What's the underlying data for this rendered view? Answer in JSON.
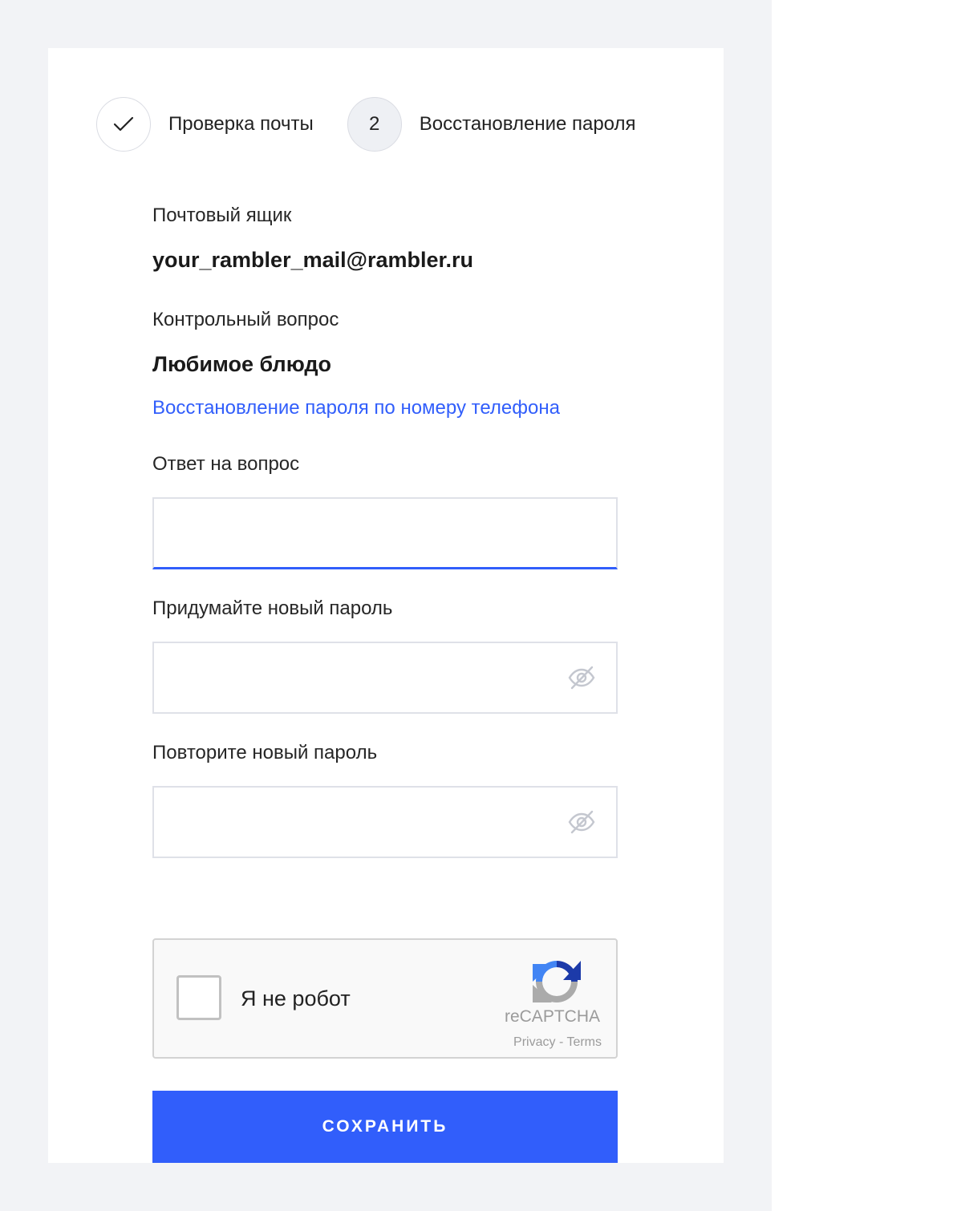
{
  "steps": [
    {
      "label": "Проверка почты",
      "state": "done",
      "icon": "check-icon"
    },
    {
      "number": "2",
      "label": "Восстановление пароля",
      "state": "active"
    }
  ],
  "mailbox": {
    "label": "Почтовый ящик",
    "value": "your_rambler_mail@rambler.ru"
  },
  "security_question": {
    "label": "Контрольный вопрос",
    "value": "Любимое блюдо"
  },
  "phone_recovery_link": "Восстановление пароля по номеру телефона",
  "answer": {
    "label": "Ответ на вопрос",
    "value": "",
    "placeholder": ""
  },
  "new_password": {
    "label": "Придумайте новый пароль",
    "value": "",
    "placeholder": "",
    "icon": "eye-hidden-icon"
  },
  "repeat_password": {
    "label": "Повторите новый пароль",
    "value": "",
    "placeholder": "",
    "icon": "eye-hidden-icon"
  },
  "captcha": {
    "checkbox_label": "Я не робот",
    "brand": "reCAPTCHA",
    "privacy": "Privacy",
    "separator": " - ",
    "terms": "Terms",
    "icon": "recaptcha-logo-icon"
  },
  "save_button": "СОХРАНИТЬ",
  "colors": {
    "accent": "#315efb",
    "backdrop": "#f2f3f6",
    "card": "#ffffff"
  }
}
